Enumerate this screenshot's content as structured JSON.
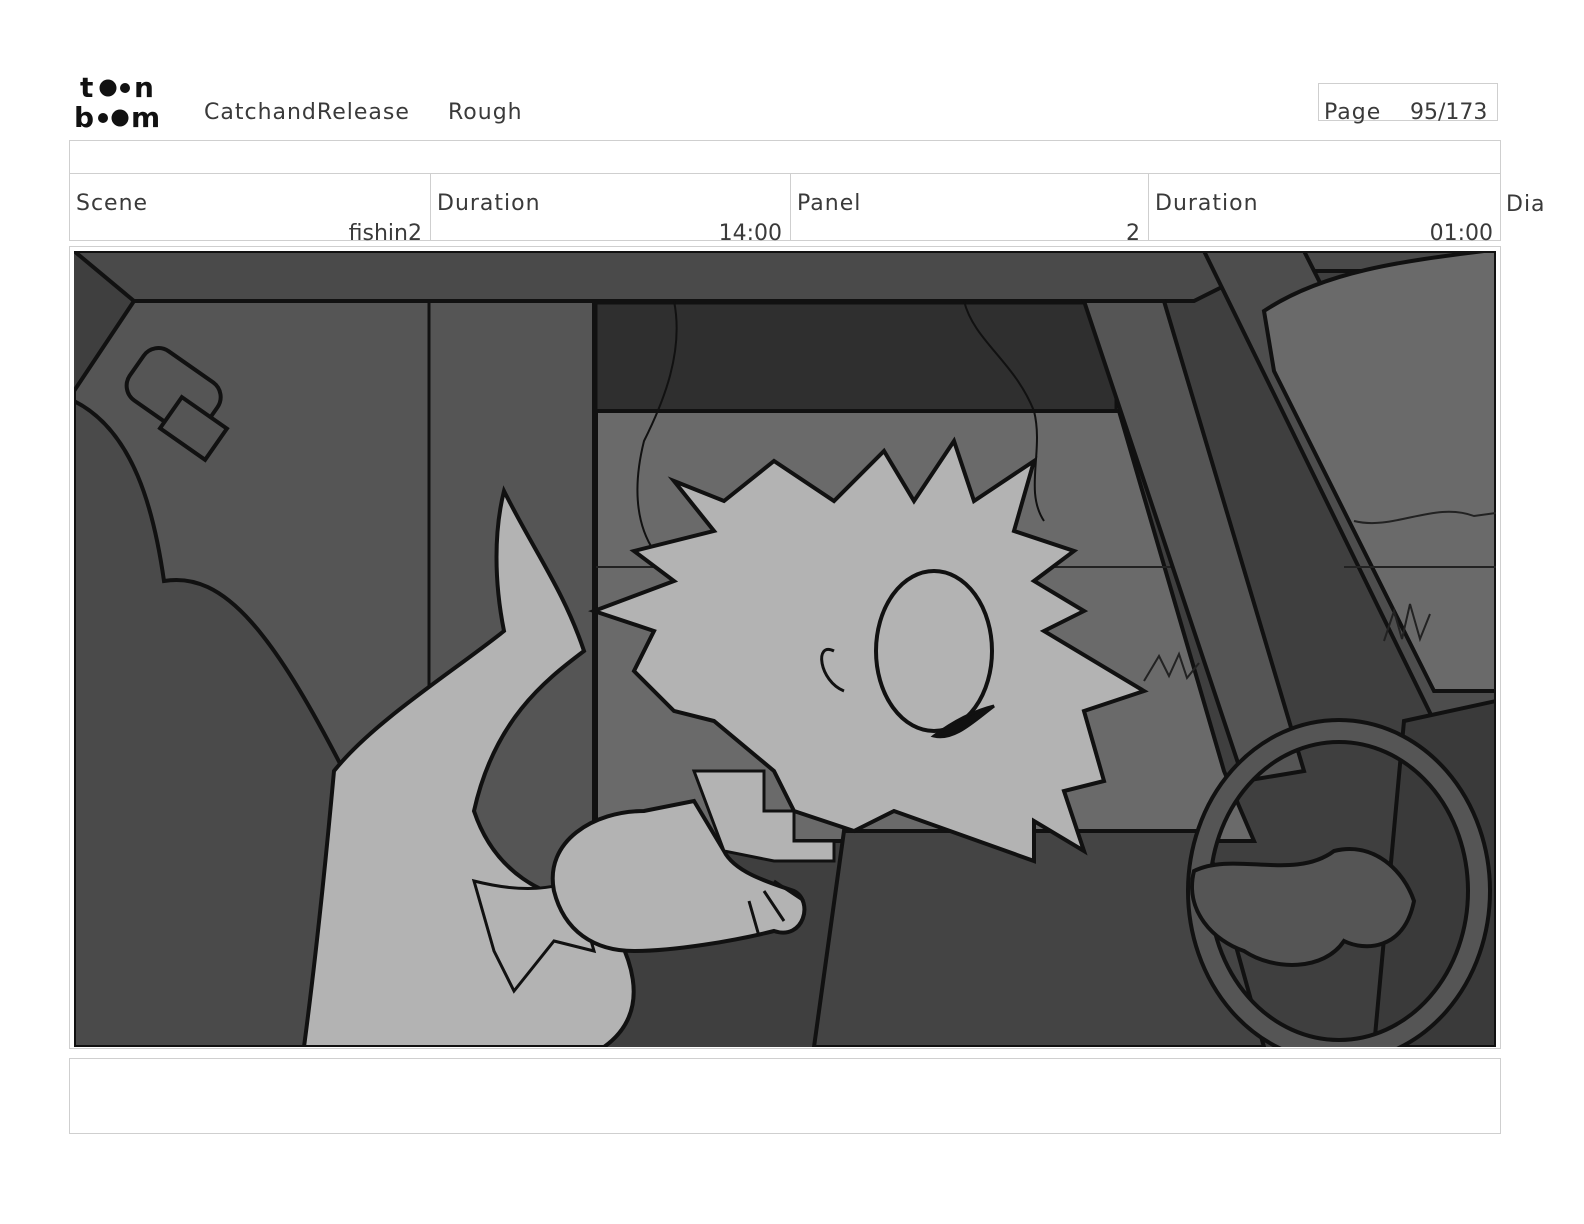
{
  "header": {
    "logo": {
      "line1": "toon",
      "line2": "boom",
      "icon": "toonboom-logo-icon"
    },
    "project": "CatchandRelease",
    "version": "Rough",
    "page_label": "Page",
    "page_value": "95/173"
  },
  "info": {
    "scene_label": "Scene",
    "scene_value": "fishin2",
    "scene_duration_label": "Duration",
    "scene_duration_value": "14:00",
    "panel_label": "Panel",
    "panel_value": "2",
    "panel_duration_label": "Duration",
    "panel_duration_value": "01:00",
    "dialog_label": "Dia"
  },
  "colors": {
    "border": "#cfcfcf",
    "text": "#3a3a3a",
    "frame_dark": "#3f3f3f",
    "frame_mid": "#555555",
    "frame_light": "#b3b3b3"
  },
  "panel_image": {
    "icon": "storyboard-panel-drawing"
  }
}
